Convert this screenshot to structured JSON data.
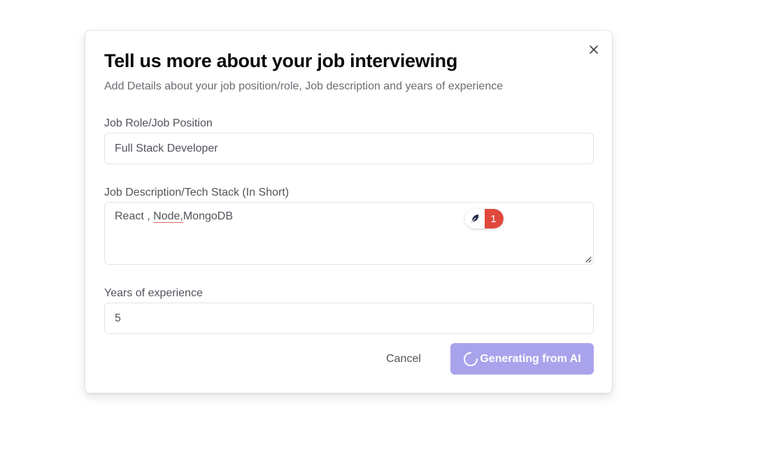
{
  "dialog": {
    "title": "Tell us more about your job interviewing",
    "subtitle": "Add Details about your job position/role, Job description and years of experience",
    "close_icon": "close-icon"
  },
  "form": {
    "job_role": {
      "label": "Job Role/Job Position",
      "value": "Full Stack Developer"
    },
    "job_description": {
      "label": "Job Description/Tech Stack (In Short)",
      "value_part1": "React , ",
      "value_part2_underlined": "Node,",
      "value_part3": "MongoDB"
    },
    "years_experience": {
      "label": "Years of experience",
      "value": "5"
    }
  },
  "grammar_widget": {
    "icon": "feather-icon",
    "count": "1",
    "count_color": "#e0483c"
  },
  "actions": {
    "cancel_label": "Cancel",
    "generate_label": "Generating from AI",
    "generate_icon": "spinner-icon",
    "generate_color": "#a9a3ec"
  }
}
